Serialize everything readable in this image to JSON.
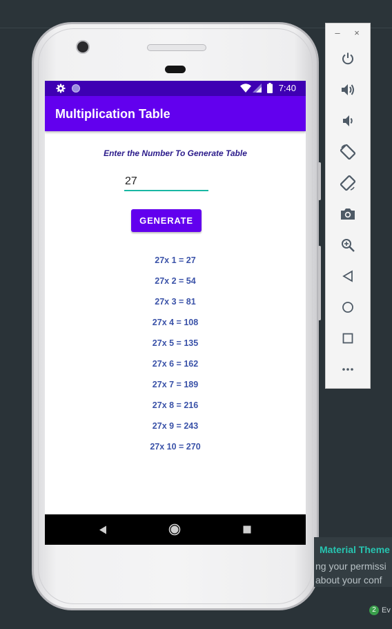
{
  "status_bar": {
    "time": "7:40"
  },
  "app_bar": {
    "title": "Multiplication Table"
  },
  "form": {
    "prompt": "Enter the Number To Generate Table",
    "number_value": "27",
    "generate_label": "GENERATE"
  },
  "results": [
    "27x 1 = 27",
    "27x 2 = 54",
    "27x 3 = 81",
    "27x 4 = 108",
    "27x 5 = 135",
    "27x 6 = 162",
    "27x 7 = 189",
    "27x 8 = 216",
    "27x 9 = 243",
    "27x 10 = 270"
  ],
  "emulator_toolbar": {
    "minimize": "–",
    "close": "×",
    "buttons": [
      "power-icon",
      "volume-up-icon",
      "volume-down-icon",
      "rotate-left-icon",
      "rotate-right-icon",
      "camera-icon",
      "zoom-icon",
      "back-icon",
      "home-icon",
      "overview-icon",
      "more-icon"
    ]
  },
  "notification": {
    "title": "Material Theme",
    "line1": "ng your permissi",
    "line2": "about your conf"
  },
  "event_log": {
    "count": "2",
    "label": "Ev"
  },
  "colors": {
    "primary": "#6200ee",
    "primary_dark": "#3e00b3",
    "accent": "#19b7a3",
    "result_text": "#3a52a8"
  }
}
